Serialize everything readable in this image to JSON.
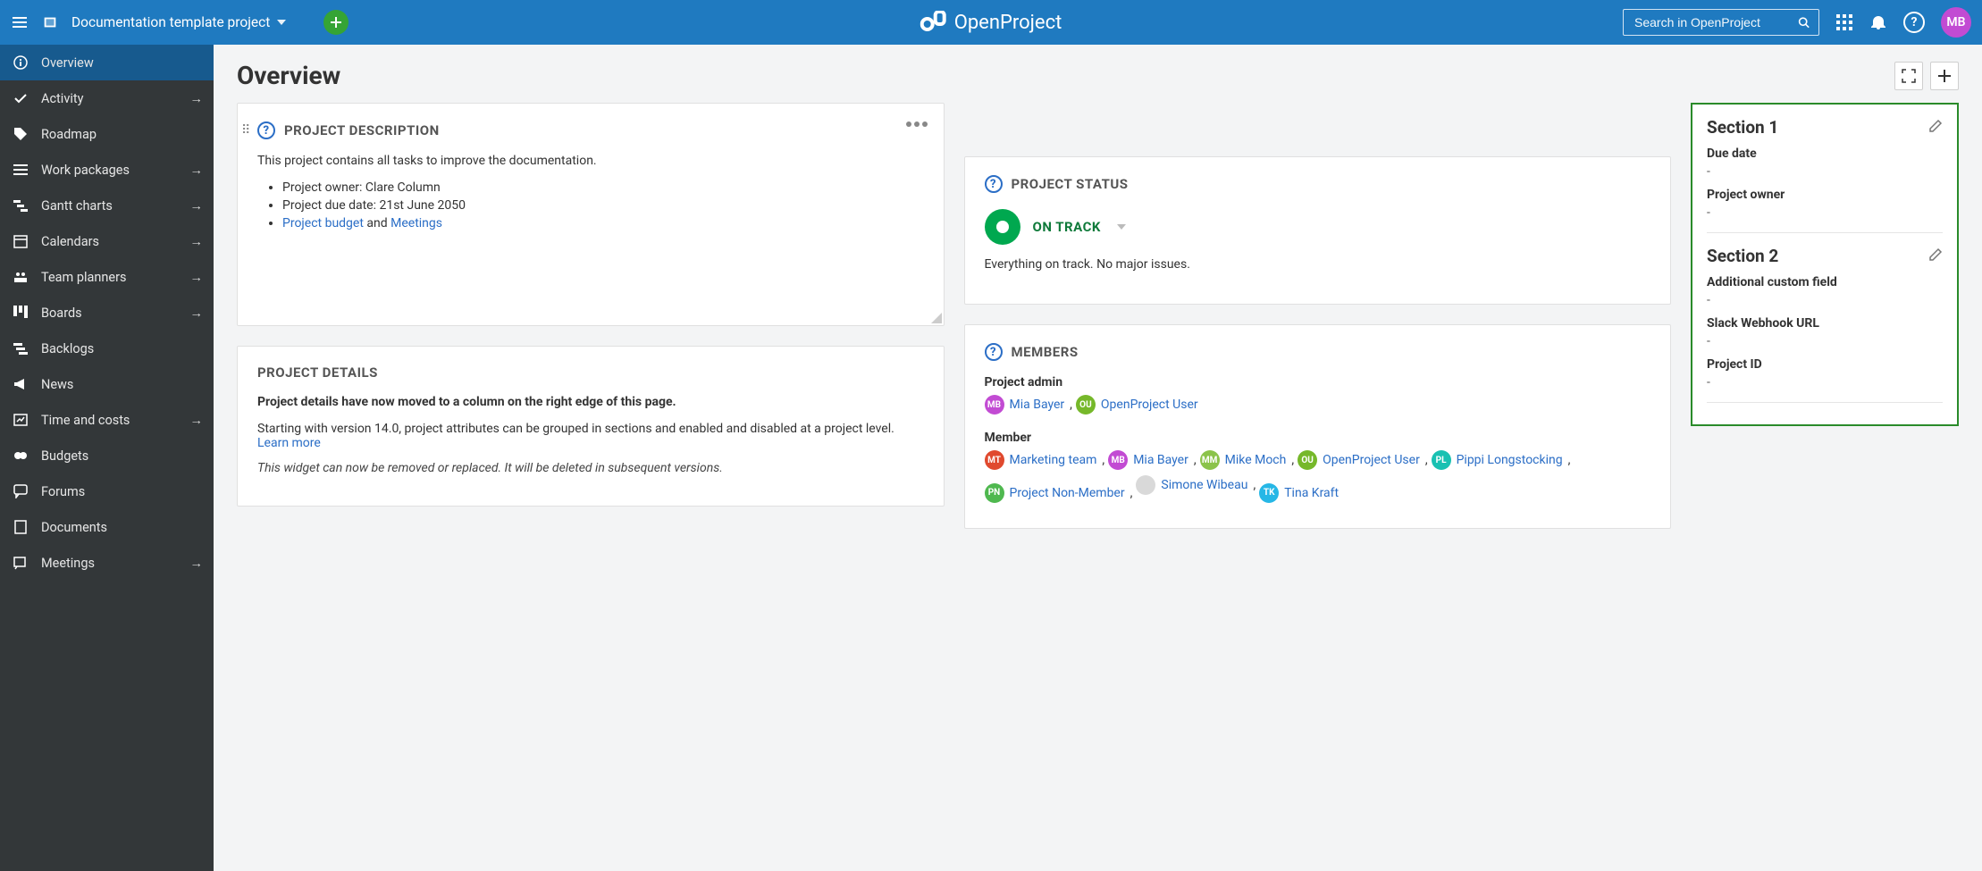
{
  "header": {
    "project_name": "Documentation template project",
    "logo_text": "OpenProject",
    "search_placeholder": "Search in OpenProject",
    "avatar_initials": "MB"
  },
  "sidebar": {
    "items": [
      {
        "label": "Overview",
        "arrow": false
      },
      {
        "label": "Activity",
        "arrow": true
      },
      {
        "label": "Roadmap",
        "arrow": false
      },
      {
        "label": "Work packages",
        "arrow": true
      },
      {
        "label": "Gantt charts",
        "arrow": true
      },
      {
        "label": "Calendars",
        "arrow": true
      },
      {
        "label": "Team planners",
        "arrow": true
      },
      {
        "label": "Boards",
        "arrow": true
      },
      {
        "label": "Backlogs",
        "arrow": false
      },
      {
        "label": "News",
        "arrow": false
      },
      {
        "label": "Time and costs",
        "arrow": true
      },
      {
        "label": "Budgets",
        "arrow": false
      },
      {
        "label": "Forums",
        "arrow": false
      },
      {
        "label": "Documents",
        "arrow": false
      },
      {
        "label": "Meetings",
        "arrow": true
      }
    ]
  },
  "page": {
    "title": "Overview",
    "description": {
      "title": "PROJECT DESCRIPTION",
      "intro": "This project contains all tasks to improve the documentation.",
      "bullet1_pre": "Project owner: ",
      "bullet1_val": "Clare Column",
      "bullet2_pre": "Project due date: ",
      "bullet2_val": "21st June 2050",
      "bullet3_link1": "Project budget",
      "bullet3_mid": " and ",
      "bullet3_link2": "Meetings"
    },
    "status": {
      "title": "PROJECT STATUS",
      "label": "ON TRACK",
      "text": "Everything on track. No major issues."
    },
    "details": {
      "title": "PROJECT DETAILS",
      "lead": "Project details have now moved to a column on the right edge of this page.",
      "body": "Starting with version 14.0, project attributes can be grouped in sections and enabled and disabled at a project level. ",
      "learn_more": "Learn more",
      "note": "This widget can now be removed or replaced. It will be deleted in subsequent versions."
    },
    "members": {
      "title": "MEMBERS",
      "role1": "Project admin",
      "role2": "Member",
      "admins": [
        {
          "initials": "MB",
          "color": "#c24bd3",
          "name": "Mia Bayer"
        },
        {
          "initials": "OU",
          "color": "#76b82a",
          "name": "OpenProject User"
        }
      ],
      "members": [
        {
          "initials": "MT",
          "color": "#e0492e",
          "name": "Marketing team"
        },
        {
          "initials": "MB",
          "color": "#c24bd3",
          "name": "Mia Bayer"
        },
        {
          "initials": "MM",
          "color": "#8bc34a",
          "name": "Mike Moch"
        },
        {
          "initials": "OU",
          "color": "#76b82a",
          "name": "OpenProject User"
        },
        {
          "initials": "PL",
          "color": "#19c1b2",
          "name": "Pippi Longstocking"
        },
        {
          "initials": "PN",
          "color": "#4fb84f",
          "name": "Project Non-Member"
        },
        {
          "initials": "",
          "color": "#d9d9d9",
          "name": "Simone Wibeau"
        },
        {
          "initials": "TK",
          "color": "#26b7e6",
          "name": "Tina Kraft"
        }
      ]
    }
  },
  "attrs": {
    "section1": {
      "title": "Section 1",
      "f1_label": "Due date",
      "f1_val": "-",
      "f2_label": "Project owner",
      "f2_val": "-"
    },
    "section2": {
      "title": "Section 2",
      "f1_label": "Additional custom field",
      "f1_val": "-",
      "f2_label": "Slack Webhook URL",
      "f2_val": "-",
      "f3_label": "Project ID",
      "f3_val": "-"
    }
  }
}
